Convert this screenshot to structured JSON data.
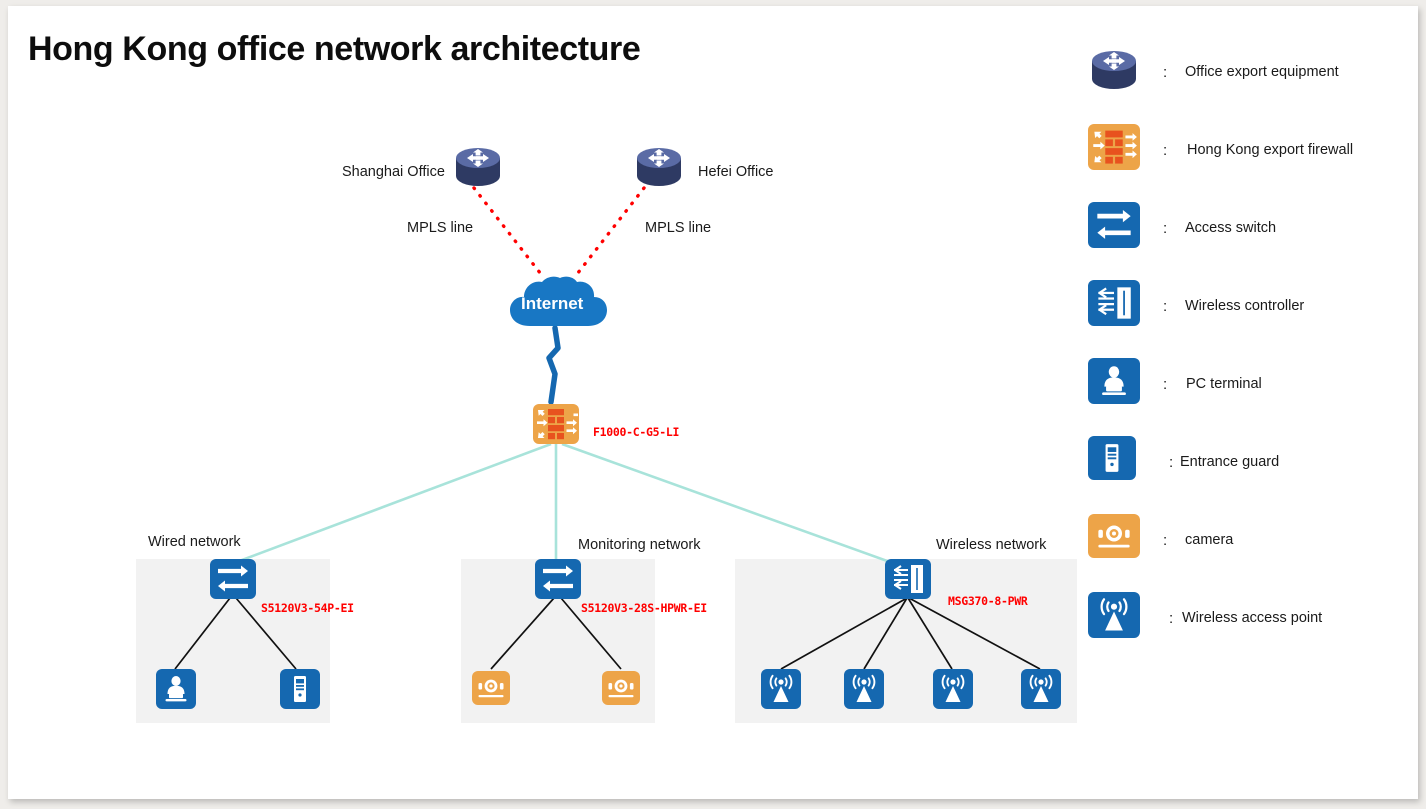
{
  "page": {
    "title": "Hong Kong office network architecture"
  },
  "diagram": {
    "branch_offices": [
      {
        "id": "shanghai",
        "label": "Shanghai Office",
        "icon": "router-icon",
        "link_label": "MPLS line",
        "link_style": "red-dotted"
      },
      {
        "id": "hefei",
        "label": "Hefei Office",
        "icon": "router-icon",
        "link_label": "MPLS line",
        "link_style": "red-dotted"
      }
    ],
    "internet": {
      "label": "Internet",
      "icon": "cloud-icon",
      "color": "#1877c4"
    },
    "firewall": {
      "label": "",
      "model": "F1000-C-G5-LI",
      "icon": "firewall-icon",
      "color": "#eda448",
      "model_color": "#ff0000"
    },
    "groups": [
      {
        "id": "wired",
        "title": "Wired network",
        "switch": {
          "icon": "access-switch-icon",
          "model": "S5120V3-54P-EI",
          "color": "#1568b0"
        },
        "endpoints": [
          {
            "icon": "pc-terminal-icon",
            "color": "#1568b0"
          },
          {
            "icon": "entrance-guard-icon",
            "color": "#1568b0"
          }
        ]
      },
      {
        "id": "monitoring",
        "title": "Monitoring network",
        "switch": {
          "icon": "access-switch-icon",
          "model": "S5120V3-28S-HPWR-EI",
          "color": "#1568b0"
        },
        "endpoints": [
          {
            "icon": "camera-icon",
            "color": "#eda448"
          },
          {
            "icon": "camera-icon",
            "color": "#eda448"
          }
        ]
      },
      {
        "id": "wireless",
        "title": "Wireless network",
        "switch": {
          "icon": "wireless-controller-icon",
          "model": "MSG370-8-PWR",
          "color": "#1568b0"
        },
        "endpoints": [
          {
            "icon": "wireless-access-point-icon",
            "color": "#1568b0"
          },
          {
            "icon": "wireless-access-point-icon",
            "color": "#1568b0"
          },
          {
            "icon": "wireless-access-point-icon",
            "color": "#1568b0"
          },
          {
            "icon": "wireless-access-point-icon",
            "color": "#1568b0"
          }
        ]
      }
    ],
    "link_colors": {
      "mpls": "#ff0000",
      "internet_to_firewall": "#1568b0",
      "firewall_to_switch": "#a8e3da",
      "switch_to_endpoint": "#111111"
    }
  },
  "legend": {
    "separator": ":",
    "items": [
      {
        "icon": "router-icon",
        "label": "Office export equipment"
      },
      {
        "icon": "firewall-icon",
        "label": "Hong Kong export firewall"
      },
      {
        "icon": "access-switch-icon",
        "label": "Access switch"
      },
      {
        "icon": "wireless-controller-icon",
        "label": "Wireless controller"
      },
      {
        "icon": "pc-terminal-icon",
        "label": "PC terminal"
      },
      {
        "icon": "entrance-guard-icon",
        "label": "Entrance guard"
      },
      {
        "icon": "camera-icon",
        "label": "camera"
      },
      {
        "icon": "wireless-access-point-icon",
        "label": "Wireless access point"
      }
    ]
  }
}
